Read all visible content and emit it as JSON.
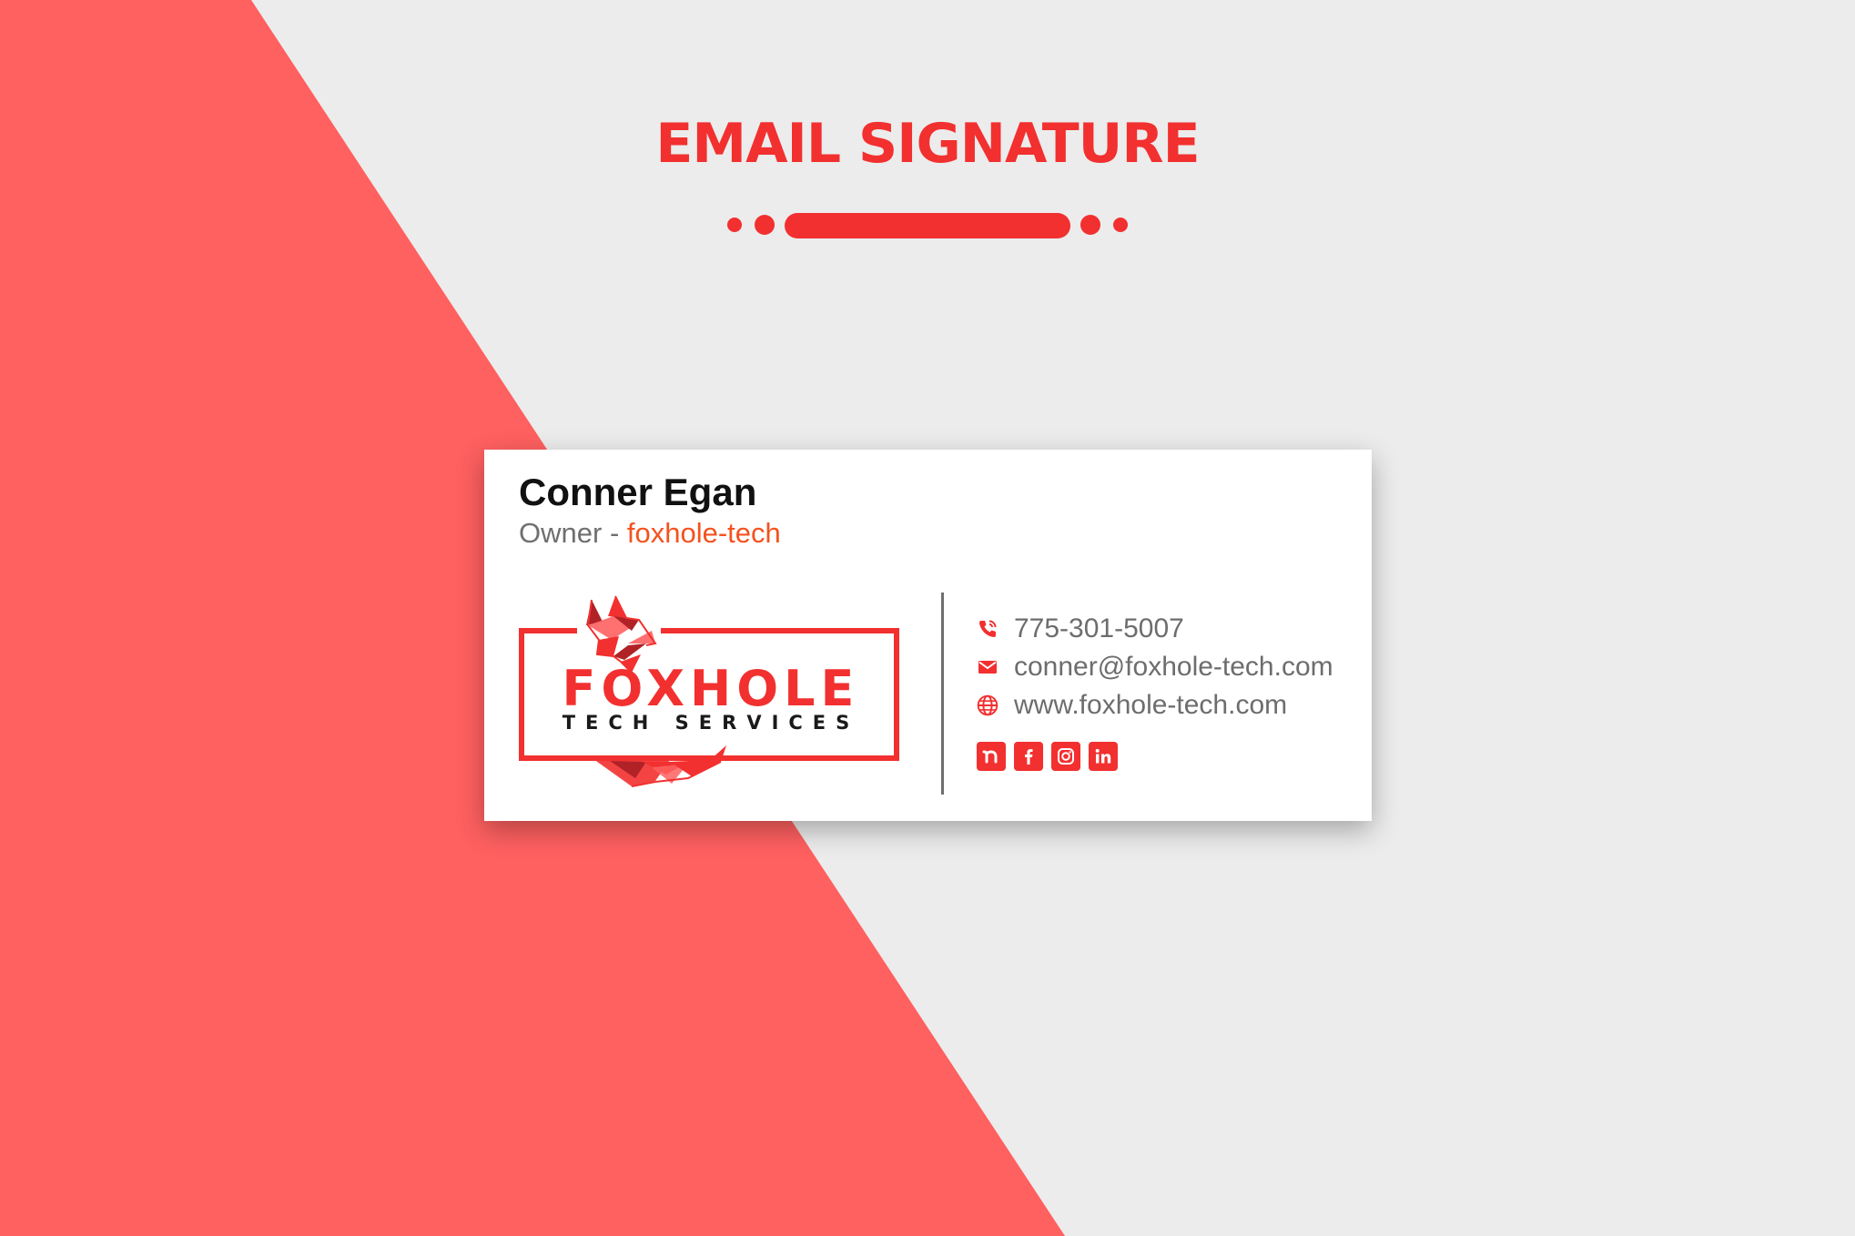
{
  "header": {
    "title": "EMAIL SIGNATURE"
  },
  "signature": {
    "name": "Conner Egan",
    "role": "Owner",
    "separator": "-",
    "company": "foxhole-tech",
    "logo": {
      "brand": "FOXHOLE",
      "tagline": "TECH SERVICES"
    },
    "contacts": [
      {
        "icon": "phone-icon",
        "text": "775-301-5007"
      },
      {
        "icon": "mail-icon",
        "text": "conner@foxhole-tech.com"
      },
      {
        "icon": "globe-icon",
        "text": "www.foxhole-tech.com"
      }
    ],
    "socials": [
      "nextdoor-icon",
      "facebook-icon",
      "instagram-icon",
      "linkedin-icon"
    ]
  },
  "colors": {
    "accent": "#f2302f",
    "panel": "#ff6060",
    "company_text": "#f4521f",
    "background": "#ececec",
    "dark_fox": "#b02226"
  }
}
